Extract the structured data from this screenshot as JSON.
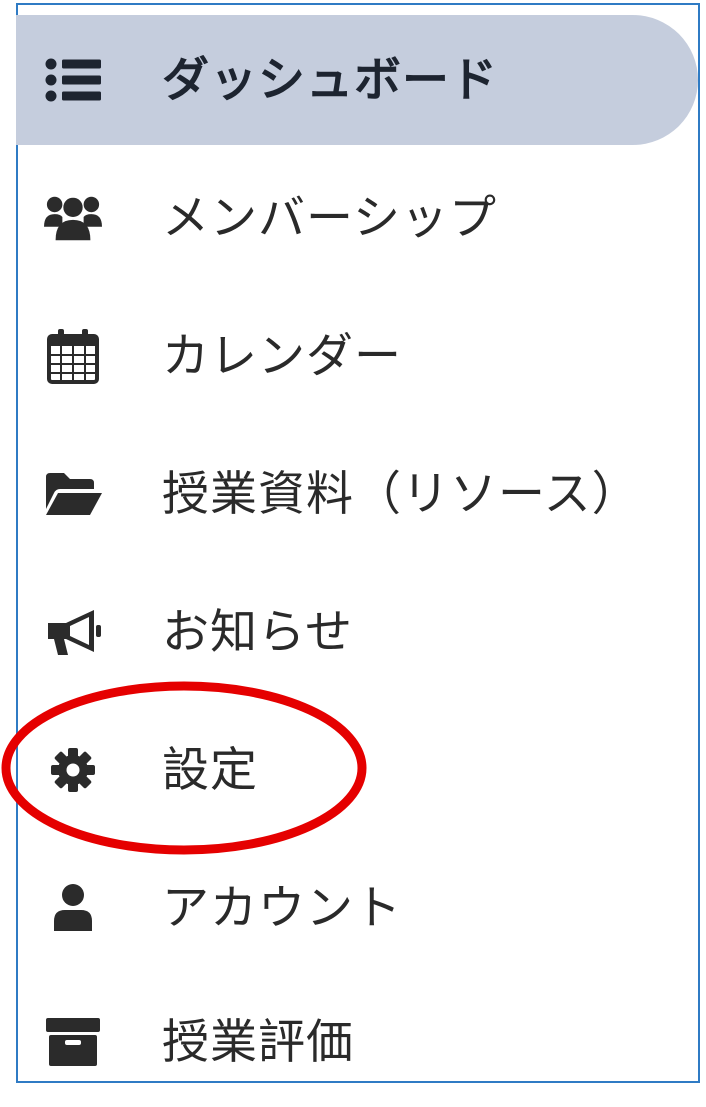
{
  "sidebar": {
    "items": [
      {
        "label": "ダッシュボード",
        "icon": "list-icon",
        "active": true
      },
      {
        "label": "メンバーシップ",
        "icon": "users-icon",
        "active": false
      },
      {
        "label": "カレンダー",
        "icon": "calendar-icon",
        "active": false
      },
      {
        "label": "授業資料（リソース）",
        "icon": "folder-open-icon",
        "active": false
      },
      {
        "label": "お知らせ",
        "icon": "megaphone-icon",
        "active": false
      },
      {
        "label": "設定",
        "icon": "gear-icon",
        "active": false,
        "highlighted": true
      },
      {
        "label": "アカウント",
        "icon": "user-icon",
        "active": false
      },
      {
        "label": "授業評価",
        "icon": "archive-icon",
        "active": false
      }
    ]
  },
  "colors": {
    "active_background": "#c5cddd",
    "frame_border": "#2f7bc4",
    "highlight_ring": "#e50000",
    "icon": "#2b2b2b"
  }
}
